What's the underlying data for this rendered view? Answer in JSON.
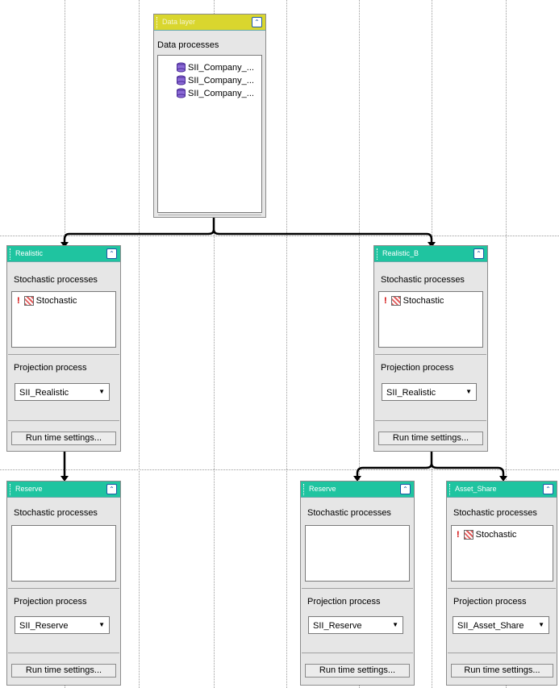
{
  "data_layer": {
    "title": "Data layer",
    "section_label": "Data processes",
    "items": [
      "SII_Company_...",
      "SII_Company_...",
      "SII_Company_..."
    ]
  },
  "nodes": {
    "realistic": {
      "title": "Realistic",
      "stochastic_label": "Stochastic processes",
      "stochastic_item": "Stochastic",
      "projection_label": "Projection process",
      "projection_value": "SII_Realistic",
      "run_button": "Run time settings..."
    },
    "realistic_b": {
      "title": "Realistic_B",
      "stochastic_label": "Stochastic processes",
      "stochastic_item": "Stochastic",
      "projection_label": "Projection process",
      "projection_value": "SII_Realistic",
      "run_button": "Run time settings..."
    },
    "reserve_left": {
      "title": "Reserve",
      "stochastic_label": "Stochastic processes",
      "projection_label": "Projection process",
      "projection_value": "SII_Reserve",
      "run_button": "Run time settings..."
    },
    "reserve_right": {
      "title": "Reserve",
      "stochastic_label": "Stochastic processes",
      "projection_label": "Projection process",
      "projection_value": "SII_Reserve",
      "run_button": "Run time settings..."
    },
    "asset_share": {
      "title": "Asset_Share",
      "stochastic_label": "Stochastic processes",
      "stochastic_item": "Stochastic",
      "projection_label": "Projection process",
      "projection_value": "SII_Asset_Share",
      "run_button": "Run time settings..."
    }
  },
  "icons": {
    "collapse": "collapse-icon",
    "warning": "warning-icon",
    "stochastic": "stochastic-icon",
    "database": "database-icon",
    "dropdown": "chevron-down-icon"
  },
  "colors": {
    "data_header": "#d9d62e",
    "node_header": "#1fc4a0",
    "connector": "#000000"
  }
}
